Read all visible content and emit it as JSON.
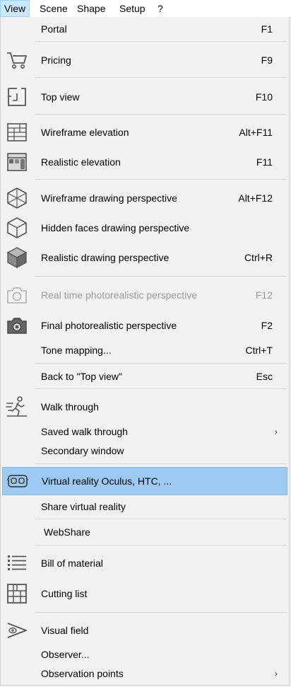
{
  "menubar": {
    "items": [
      "View",
      "Scene",
      "Shape",
      "Setup",
      "?"
    ],
    "active": "View"
  },
  "menu": {
    "items": [
      {
        "label": "Portal",
        "shortcut": "F1"
      },
      {
        "label": "Pricing",
        "shortcut": "F9",
        "icon": "shopping-cart-icon"
      },
      {
        "label": "Top view",
        "shortcut": "F10",
        "icon": "floor-plan-icon"
      },
      {
        "label": "Wireframe elevation",
        "shortcut": "Alt+F11",
        "icon": "wireframe-elevation-icon"
      },
      {
        "label": "Realistic elevation",
        "shortcut": "F11",
        "icon": "realistic-elevation-icon"
      },
      {
        "label": "Wireframe drawing perspective",
        "shortcut": "Alt+F12",
        "icon": "wireframe-cube-icon"
      },
      {
        "label": "Hidden faces drawing perspective",
        "shortcut": "",
        "icon": "outline-cube-icon"
      },
      {
        "label": "Realistic drawing perspective",
        "shortcut": "Ctrl+R",
        "icon": "solid-cube-icon"
      },
      {
        "label": "Real time photorealistic perspective",
        "shortcut": "F12",
        "icon": "camera-outline-icon",
        "disabled": true
      },
      {
        "label": "Final photorealistic perspective",
        "shortcut": "F2",
        "icon": "camera-icon"
      },
      {
        "label": "Tone mapping...",
        "shortcut": "Ctrl+T"
      },
      {
        "label": "Back to \"Top view\"",
        "shortcut": "Esc"
      },
      {
        "label": "Walk through",
        "shortcut": "",
        "icon": "walking-person-icon"
      },
      {
        "label": "Saved walk through",
        "shortcut": "",
        "submenu": true
      },
      {
        "label": "Secondary window",
        "shortcut": ""
      },
      {
        "label": "Virtual reality Oculus, HTC, ...",
        "shortcut": "",
        "icon": "vr-headset-icon",
        "highlighted": true
      },
      {
        "label": "Share virtual reality",
        "shortcut": ""
      },
      {
        "label": "WebShare",
        "shortcut": ""
      },
      {
        "label": "Bill of material",
        "shortcut": "",
        "icon": "list-icon"
      },
      {
        "label": "Cutting list",
        "shortcut": "",
        "icon": "cutting-grid-icon"
      },
      {
        "label": "Visual field",
        "shortcut": "",
        "icon": "eye-field-icon"
      },
      {
        "label": "Observer...",
        "shortcut": ""
      },
      {
        "label": "Observation points",
        "shortcut": "",
        "submenu": true
      }
    ],
    "submenu_arrow": "›"
  },
  "colors": {
    "highlight": "#9dcaf2",
    "menu_background": "#f2f2f2",
    "active_menubar_item": "#cce8ff",
    "disabled_text": "#9a9a9a"
  }
}
